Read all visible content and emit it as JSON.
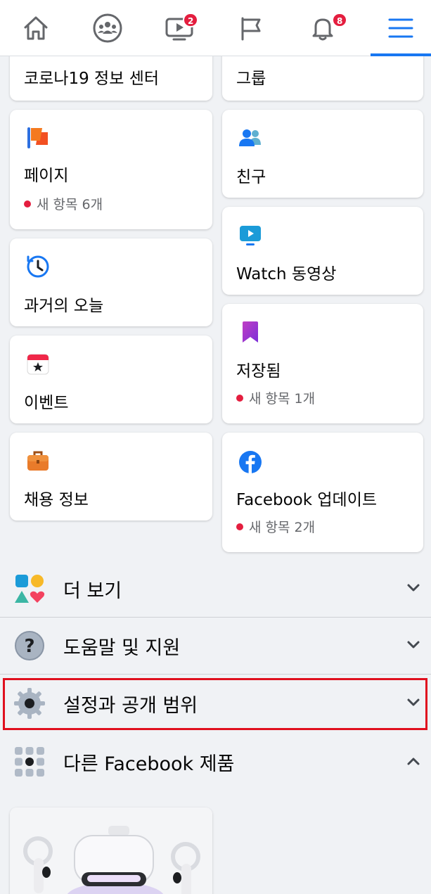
{
  "nav": {
    "video_badge": "2",
    "notifications_badge": "8",
    "icons": [
      "home-icon",
      "groups-icon",
      "watch-icon",
      "pages-flag-icon",
      "bell-icon",
      "menu-icon"
    ]
  },
  "shortcuts": {
    "left": [
      {
        "title": "코로나19 정보 센터"
      },
      {
        "title": "페이지",
        "sub": "새 항목 6개"
      },
      {
        "title": "과거의 오늘"
      },
      {
        "title": "이벤트"
      },
      {
        "title": "채용 정보"
      }
    ],
    "right": [
      {
        "title": "그룹"
      },
      {
        "title": "친구"
      },
      {
        "title": "Watch 동영상"
      },
      {
        "title": "저장됨",
        "sub": "새 항목 1개"
      },
      {
        "title": "Facebook 업데이트",
        "sub": "새 항목 2개"
      }
    ]
  },
  "rows": {
    "see_more": "더 보기",
    "help": "도움말 및 지원",
    "settings": "설정과 공개 범위",
    "other_products": "다른 Facebook 제품"
  },
  "colors": {
    "accent": "#1877f2",
    "badge": "#e41e3f",
    "highlight_box": "#e0101e"
  }
}
